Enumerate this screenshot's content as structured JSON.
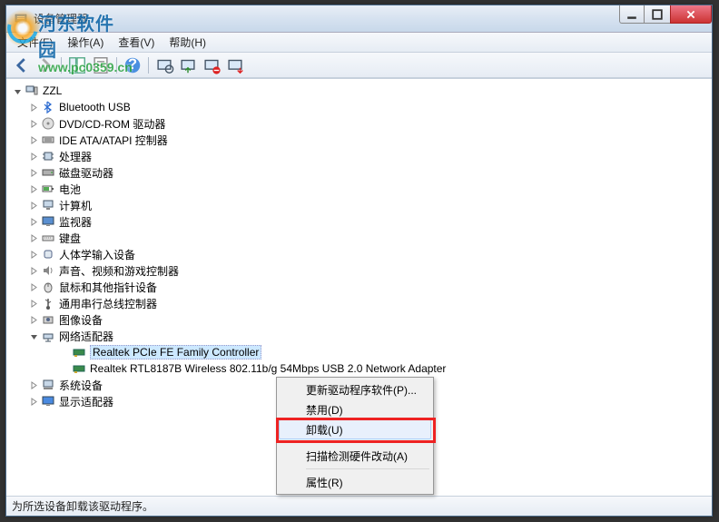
{
  "window": {
    "title": "设备管理器"
  },
  "menubar": {
    "items": [
      "文件(F)",
      "操作(A)",
      "查看(V)",
      "帮助(H)"
    ]
  },
  "tree": {
    "root": "ZZL",
    "categories": [
      {
        "label": "Bluetooth USB",
        "icon": "bluetooth"
      },
      {
        "label": "DVD/CD-ROM 驱动器",
        "icon": "disc"
      },
      {
        "label": "IDE ATA/ATAPI 控制器",
        "icon": "ide"
      },
      {
        "label": "处理器",
        "icon": "cpu"
      },
      {
        "label": "磁盘驱动器",
        "icon": "disk"
      },
      {
        "label": "电池",
        "icon": "battery"
      },
      {
        "label": "计算机",
        "icon": "computer"
      },
      {
        "label": "监视器",
        "icon": "monitor"
      },
      {
        "label": "键盘",
        "icon": "keyboard"
      },
      {
        "label": "人体学输入设备",
        "icon": "hid"
      },
      {
        "label": "声音、视频和游戏控制器",
        "icon": "sound"
      },
      {
        "label": "鼠标和其他指针设备",
        "icon": "mouse"
      },
      {
        "label": "通用串行总线控制器",
        "icon": "usb"
      },
      {
        "label": "图像设备",
        "icon": "imaging"
      },
      {
        "label": "网络适配器",
        "icon": "network",
        "expanded": true,
        "children": [
          {
            "label": "Realtek PCIe FE Family Controller",
            "selected": true
          },
          {
            "label": "Realtek RTL8187B Wireless 802.11b/g 54Mbps USB 2.0 Network Adapter"
          }
        ]
      },
      {
        "label": "系统设备",
        "icon": "system"
      },
      {
        "label": "显示适配器",
        "icon": "display"
      }
    ]
  },
  "context_menu": {
    "items": [
      {
        "label": "更新驱动程序软件(P)..."
      },
      {
        "label": "禁用(D)"
      },
      {
        "label": "卸载(U)",
        "highlighted": true
      },
      {
        "sep": true
      },
      {
        "label": "扫描检测硬件改动(A)"
      },
      {
        "sep": true
      },
      {
        "label": "属性(R)"
      }
    ]
  },
  "statusbar": {
    "text": "为所选设备卸载该驱动程序。"
  },
  "watermark": {
    "line1": "河东软件园",
    "line2": "www.pc0359.cn"
  }
}
